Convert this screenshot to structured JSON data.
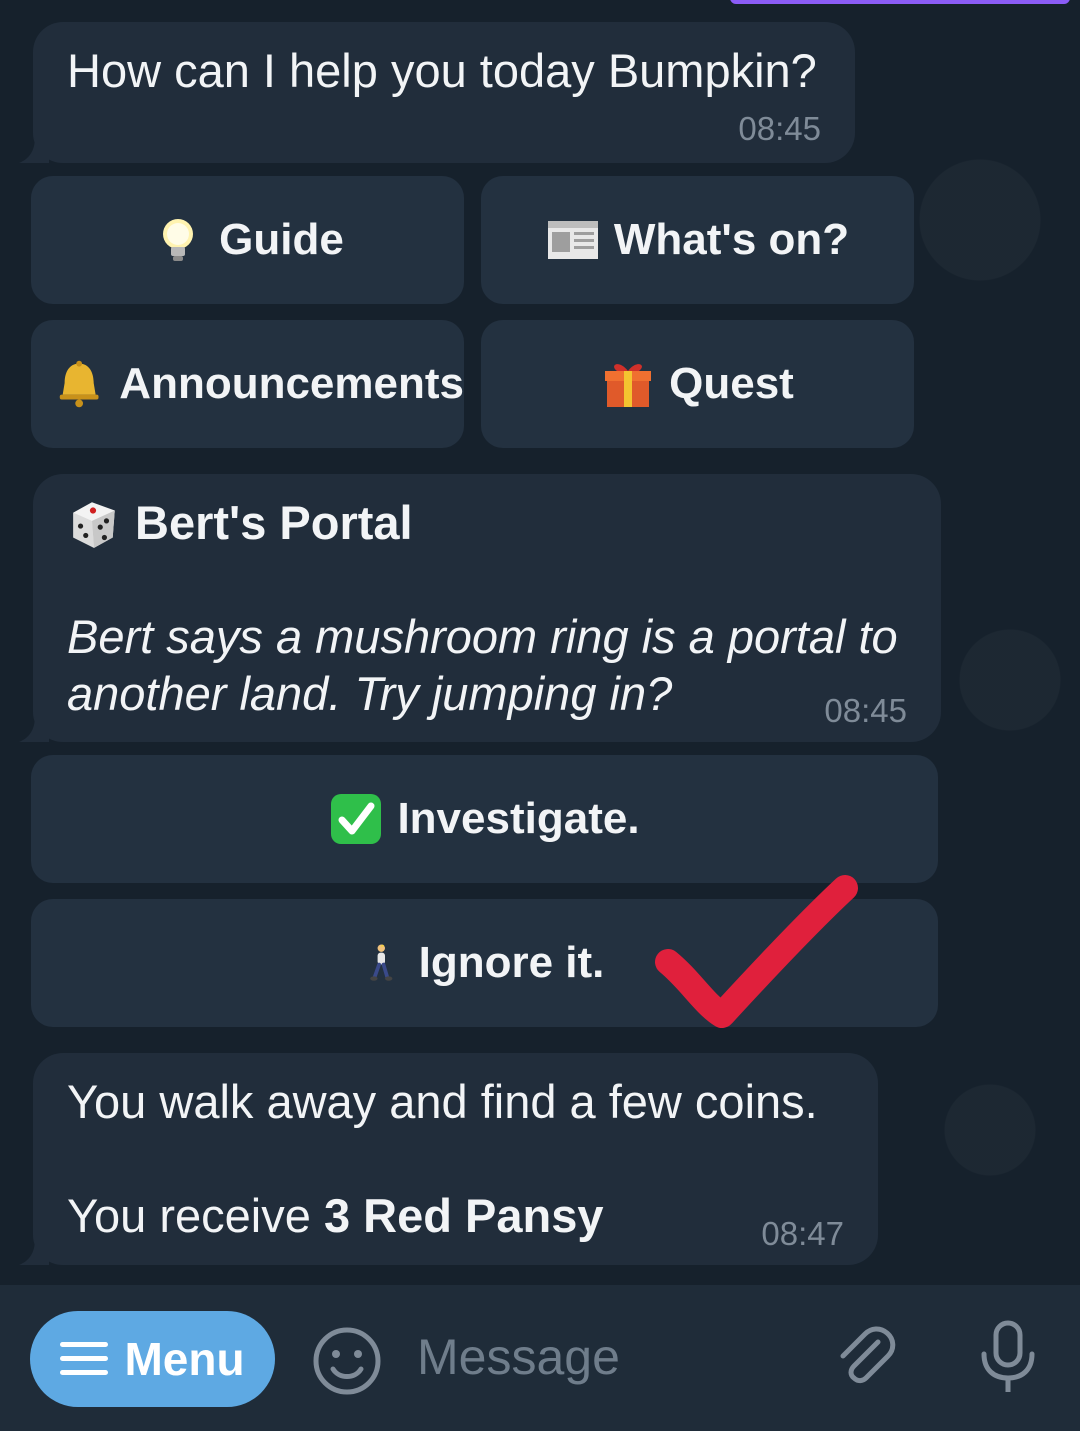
{
  "messages": {
    "greeting": {
      "text": "How can I help you today Bumpkin?",
      "time": "08:45"
    },
    "portal": {
      "title": "Bert's Portal",
      "body_line1": "Bert says a mushroom ring is a portal to",
      "body_line2": "another land. Try jumping in?",
      "time": "08:45"
    },
    "result": {
      "line1": "You walk away and find a few coins.",
      "line2_prefix": "You receive ",
      "line2_bold": "3 Red Pansy",
      "time": "08:47"
    }
  },
  "keyboard_main": [
    {
      "label": "Guide",
      "icon": "lightbulb-icon"
    },
    {
      "label": "What's on?",
      "icon": "newspaper-icon"
    },
    {
      "label": "Announcements",
      "icon": "bell-icon"
    },
    {
      "label": "Quest",
      "icon": "gift-icon"
    }
  ],
  "keyboard_choice": [
    {
      "label": "Investigate.",
      "icon": "check-box-icon"
    },
    {
      "label": "Ignore it.",
      "icon": "walking-person-icon"
    }
  ],
  "composer": {
    "menu_label": "Menu",
    "placeholder": "Message"
  },
  "colors": {
    "background": "#16212c",
    "bubble": "#212d3b",
    "keyboard_button": "#233140",
    "menu_button": "#5ea9e3",
    "annotation_check": "#e0203c"
  }
}
